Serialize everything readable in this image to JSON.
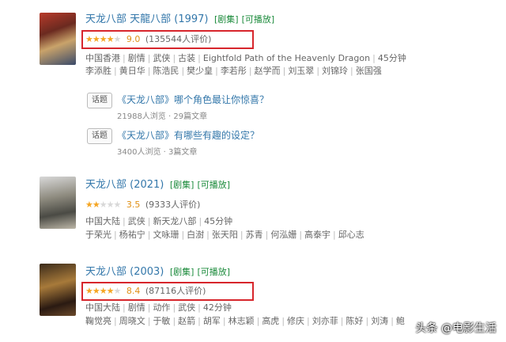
{
  "entries": [
    {
      "title": "天龙八部 天龍八部 (1997)",
      "tag1": "[剧集]",
      "tag2": "[可播放]",
      "stars": "★★★★",
      "stars_off": "★",
      "score": "9.0",
      "votes": "(135544人评价)",
      "meta1": [
        "中国香港",
        "剧情",
        "武侠",
        "古装",
        "Eightfold Path of the Heavenly Dragon",
        "45分钟"
      ],
      "meta2": [
        "李添胜",
        "黄日华",
        "陈浩民",
        "樊少皇",
        "李若彤",
        "赵学而",
        "刘玉翠",
        "刘锦玲",
        "张国强"
      ],
      "topics": [
        {
          "badge": "话题",
          "title": "《天龙八部》哪个角色最让你惊喜？",
          "stats": "21988人浏览 · 29篇文章"
        },
        {
          "badge": "话题",
          "title": "《天龙八部》有哪些有趣的设定？",
          "stats": "3400人浏览 · 3篇文章"
        }
      ]
    },
    {
      "title": "天龙八部 (2021)",
      "tag1": "[剧集]",
      "tag2": "[可播放]",
      "stars": "★★",
      "stars_off": "★★★",
      "score": "3.5",
      "votes": "(9333人评价)",
      "meta1": [
        "中国大陆",
        "武侠",
        "新天龙八部",
        "45分钟"
      ],
      "meta2": [
        "于荣光",
        "杨祐宁",
        "文咏珊",
        "白澍",
        "张天阳",
        "苏青",
        "何泓姗",
        "高泰宇",
        "邱心志"
      ]
    },
    {
      "title": "天龙八部 (2003)",
      "tag1": "[剧集]",
      "tag2": "[可播放]",
      "stars": "★★★★",
      "stars_off": "★",
      "score": "8.4",
      "votes": "(87116人评价)",
      "meta1": [
        "中国大陆",
        "剧情",
        "动作",
        "武侠",
        "42分钟"
      ],
      "meta2": [
        "鞠觉亮",
        "周晓文",
        "于敏",
        "赵箭",
        "胡军",
        "林志颖",
        "高虎",
        "修庆",
        "刘亦菲",
        "陈好",
        "刘涛",
        "鲍"
      ]
    }
  ],
  "watermark": "头条 @电影生活",
  "colors": {
    "link": "#3377aa",
    "tag": "#1a8a3a",
    "star": "#f5a623",
    "highlight_box": "#d7262c"
  }
}
